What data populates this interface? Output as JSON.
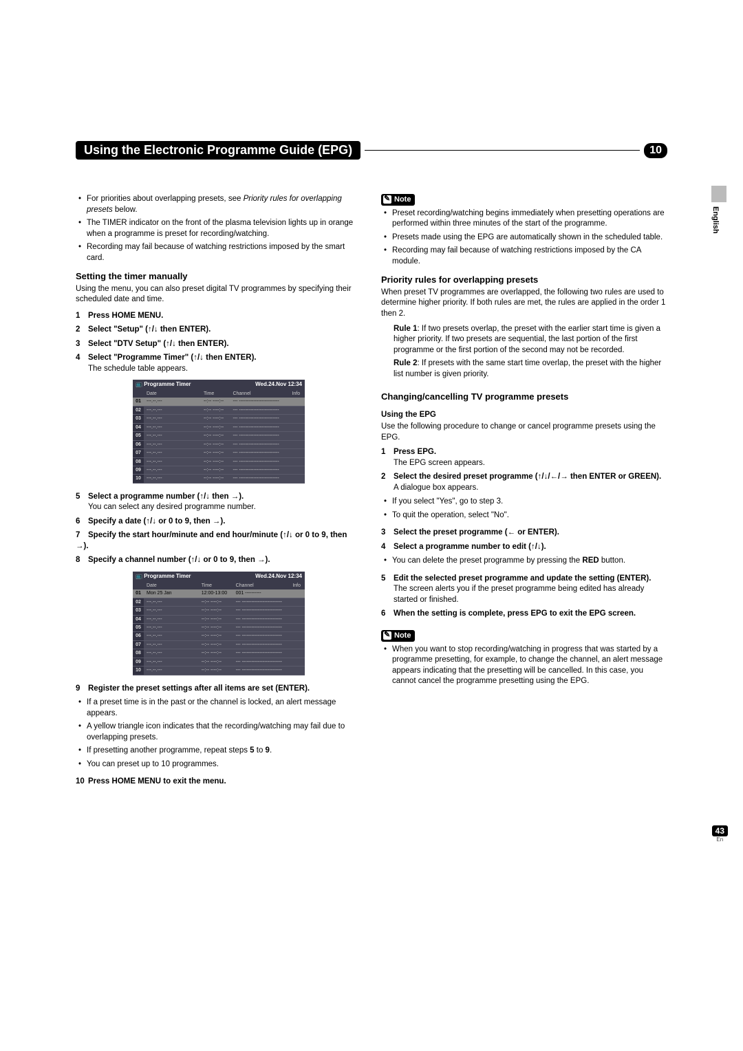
{
  "page": {
    "title": "Using the Electronic Programme Guide (EPG)",
    "chapter_number": "10",
    "page_number": "43",
    "page_lang_abbr": "En",
    "side_language": "English"
  },
  "icons": {
    "updown": "↑/↓",
    "right": "→",
    "left": "←",
    "leftright": "←/→"
  },
  "timer_table": {
    "title": "Programme Timer",
    "timestamp": "Wed.24.Nov 12:34",
    "headers": {
      "date": "Date",
      "time": "Time",
      "channel": "Channel",
      "info": "Info"
    },
    "rows1": [
      {
        "n": "01",
        "date": "---.--.---",
        "time": "--:-- ----:--",
        "channel": "--- -------------------------",
        "sel": true
      },
      {
        "n": "02",
        "date": "---.--.---",
        "time": "--:-- ----:--",
        "channel": "--- -------------------------"
      },
      {
        "n": "03",
        "date": "---.--.---",
        "time": "--:-- ----:--",
        "channel": "--- -------------------------"
      },
      {
        "n": "04",
        "date": "---.--.---",
        "time": "--:-- ----:--",
        "channel": "--- -------------------------"
      },
      {
        "n": "05",
        "date": "---.--.---",
        "time": "--:-- ----:--",
        "channel": "--- -------------------------"
      },
      {
        "n": "06",
        "date": "---.--.---",
        "time": "--:-- ----:--",
        "channel": "--- -------------------------"
      },
      {
        "n": "07",
        "date": "---.--.---",
        "time": "--:-- ----:--",
        "channel": "--- -------------------------"
      },
      {
        "n": "08",
        "date": "---.--.---",
        "time": "--:-- ----:--",
        "channel": "--- -------------------------"
      },
      {
        "n": "09",
        "date": "---.--.---",
        "time": "--:-- ----:--",
        "channel": "--- -------------------------"
      },
      {
        "n": "10",
        "date": "---.--.---",
        "time": "--:-- ----:--",
        "channel": "--- -------------------------"
      }
    ],
    "rows2": [
      {
        "n": "01",
        "date": "Mon 25 Jan",
        "time": "12:00-13:00",
        "channel": "001 ----------",
        "sel": true
      },
      {
        "n": "02",
        "date": "---.--.---",
        "time": "--:-- ----:--",
        "channel": "--- -------------------------"
      },
      {
        "n": "03",
        "date": "---.--.---",
        "time": "--:-- ----:--",
        "channel": "--- -------------------------"
      },
      {
        "n": "04",
        "date": "---.--.---",
        "time": "--:-- ----:--",
        "channel": "--- -------------------------"
      },
      {
        "n": "05",
        "date": "---.--.---",
        "time": "--:-- ----:--",
        "channel": "--- -------------------------"
      },
      {
        "n": "06",
        "date": "---.--.---",
        "time": "--:-- ----:--",
        "channel": "--- -------------------------"
      },
      {
        "n": "07",
        "date": "---.--.---",
        "time": "--:-- ----:--",
        "channel": "--- -------------------------"
      },
      {
        "n": "08",
        "date": "---.--.---",
        "time": "--:-- ----:--",
        "channel": "--- -------------------------"
      },
      {
        "n": "09",
        "date": "---.--.---",
        "time": "--:-- ----:--",
        "channel": "--- -------------------------"
      },
      {
        "n": "10",
        "date": "---.--.---",
        "time": "--:-- ----:--",
        "channel": "--- -------------------------"
      }
    ]
  },
  "left": {
    "intro_bullets": {
      "b1a": "For priorities about overlapping presets, see ",
      "b1b": "Priority rules for overlapping presets",
      "b1c": " below.",
      "b2": "The TIMER indicator on the front of the plasma television lights up in orange when a programme is preset for recording/watching.",
      "b3": "Recording may fail because of watching restrictions imposed by the smart card."
    },
    "h_manual": "Setting the timer manually",
    "manual_intro": "Using the menu, you can also preset digital TV programmes by specifying their scheduled date and time.",
    "steps_a": {
      "s1": "Press HOME MENU.",
      "s2a": "Select \"Setup\" (",
      "s2b": " then ENTER).",
      "s3a": "Select \"DTV Setup\" (",
      "s3b": " then ENTER).",
      "s4a": "Select \"Programme Timer\" (",
      "s4b": " then ENTER).",
      "s4sub": "The schedule table appears."
    },
    "steps_b": {
      "s5a": "Select a programme number (",
      "s5b": " then ",
      "s5c": ").",
      "s5sub": "You can select any desired programme number.",
      "s6a": "Specify a date (",
      "s6b": " or 0 to 9, then ",
      "s6c": ").",
      "s7a": "Specify the start hour/minute and end hour/minute (",
      "s7b": " or 0 to 9, then ",
      "s7c": ").",
      "s8a": "Specify a channel number (",
      "s8b": " or 0 to 9, then ",
      "s8c": ")."
    },
    "steps_c": {
      "s9": "Register the preset settings after all items are set (ENTER).",
      "s9b1": "If a preset time is in the past or the channel is locked, an alert message appears.",
      "s9b2": "A yellow triangle icon indicates that the recording/watching may fail due to overlapping presets.",
      "s9b3a": "If presetting another programme, repeat steps ",
      "s9b3b": "5",
      "s9b3c": " to ",
      "s9b3d": "9",
      "s9b3e": ".",
      "s9b4": "You can preset up to 10 programmes.",
      "s10": "Press HOME MENU to exit the menu."
    }
  },
  "right": {
    "note_label": "Note",
    "note1_bullets": {
      "b1": "Preset recording/watching begins immediately when presetting operations are performed within three minutes of the start of the programme.",
      "b2": "Presets made using the EPG are automatically shown in the scheduled table.",
      "b3": "Recording may fail because of watching restrictions imposed by the CA module."
    },
    "h_priority": "Priority rules for overlapping presets",
    "priority_intro": "When preset TV programmes are overlapped, the following two rules are used to determine higher priority. If both rules are met, the rules are applied in the order 1 then 2.",
    "rule1_label": "Rule 1",
    "rule1_text": ": If two presets overlap, the preset with the earlier start time is given a higher priority. If two presets are sequential, the last portion of the first programme or the first portion of the second may not be recorded.",
    "rule2_label": "Rule 2",
    "rule2_text": ": If presets with the same start time overlap, the preset with the higher list number is given priority.",
    "h_change": "Changing/cancelling TV programme presets",
    "h_using_epg": "Using the EPG",
    "using_epg_intro": "Use the following procedure to change or cancel programme presets using the EPG.",
    "epg_steps": {
      "s1": "Press EPG.",
      "s1sub": "The EPG screen appears.",
      "s2a": "Select the desired preset programme (",
      "s2b": "/",
      "s2c": " then ENTER or GREEN).",
      "s2sub": "A dialogue box appears.",
      "s2b1": "If you select \"Yes\", go to step 3.",
      "s2b2": "To quit the operation, select \"No\".",
      "s3a": "Select the preset programme (",
      "s3b": " or ENTER).",
      "s4a": "Select a programme number to edit (",
      "s4b": ").",
      "s4bullet_a": "You can delete the preset programme by pressing the ",
      "s4bullet_b": "RED",
      "s4bullet_c": " button.",
      "s5": "Edit the selected preset programme and update the setting (ENTER).",
      "s5sub": "The screen alerts you if the preset programme being edited has already started or finished.",
      "s6": "When the setting is complete, press EPG to exit the EPG screen."
    },
    "note2_bullet": "When you want to stop recording/watching in progress that was started by a programme presetting, for example, to change the channel, an alert message appears indicating that the presetting will be cancelled. In this case, you cannot cancel the programme presetting using the EPG."
  }
}
